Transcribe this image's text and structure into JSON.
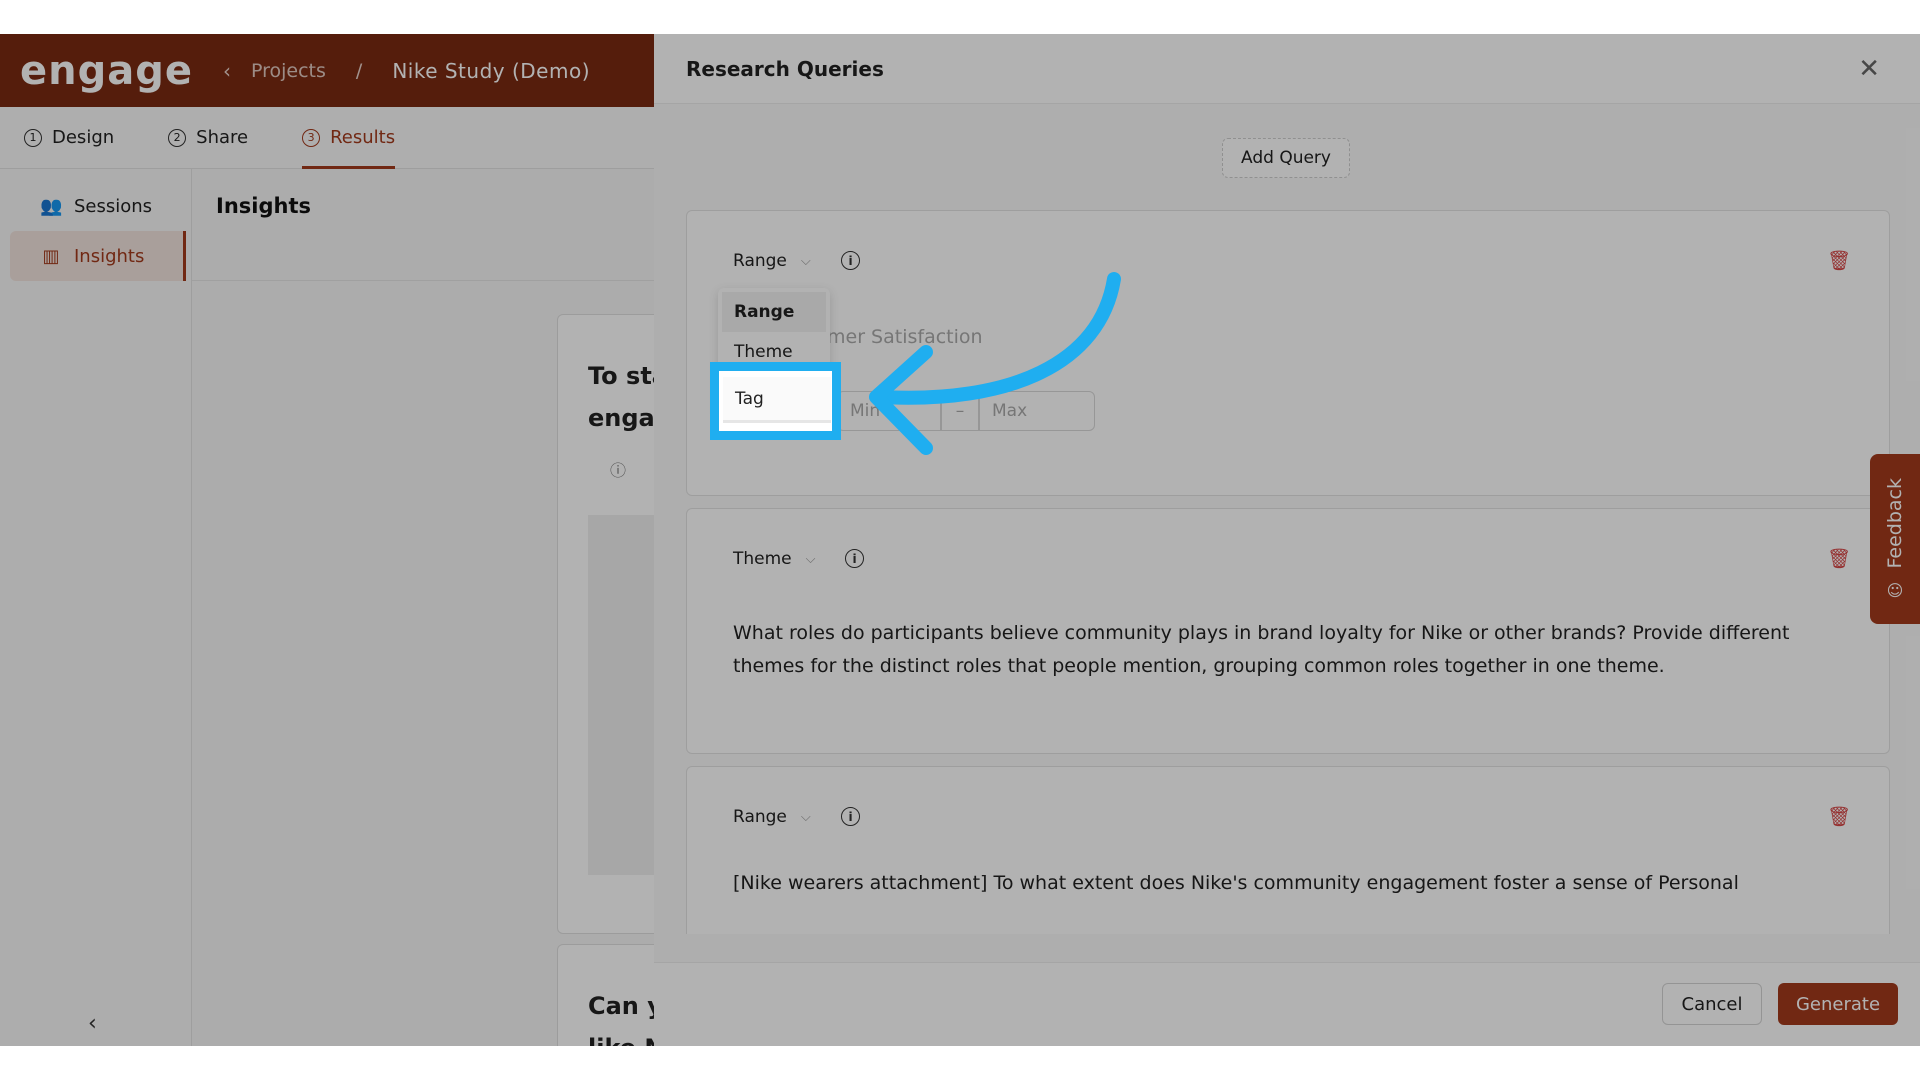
{
  "app": {
    "logo": "engage",
    "breadcrumb": {
      "back_icon": "chevron-left-icon",
      "projects": "Projects",
      "separator": "/",
      "current": "Nike Study (Demo)"
    },
    "tabs": [
      {
        "num": "1",
        "label": "Design"
      },
      {
        "num": "2",
        "label": "Share"
      },
      {
        "num": "3",
        "label": "Results"
      }
    ],
    "sidebar": [
      {
        "label": "Sessions",
        "icon": "users-icon"
      },
      {
        "label": "Insights",
        "icon": "chart-icon"
      }
    ],
    "content_title": "Insights",
    "cards": [
      {
        "title_line1": "To sta",
        "title_line2": "enga"
      },
      {
        "title_line1": "Can y",
        "title_line2": "like N"
      }
    ]
  },
  "drawer": {
    "title": "Research Queries",
    "add_query": "Add Query",
    "queries": [
      {
        "type": "Range",
        "text": "mer Satisfaction",
        "min_placeholder": "Min",
        "range_sep": "–",
        "max_placeholder": "Max"
      },
      {
        "type": "Theme",
        "text": "What roles do participants believe community plays in brand loyalty for Nike or other brands? Provide different themes for the distinct roles that people mention, grouping common roles together in one theme."
      },
      {
        "type": "Range",
        "text": "[Nike wearers attachment] To what extent does Nike's community engagement foster a sense of Personal"
      }
    ],
    "dropdown_options": [
      "Range",
      "Theme",
      "Tag"
    ],
    "cancel": "Cancel",
    "generate": "Generate"
  },
  "feedback": "Feedback",
  "colors": {
    "brand": "#a33a1c",
    "highlight": "#1faef0",
    "danger": "#d64545"
  }
}
